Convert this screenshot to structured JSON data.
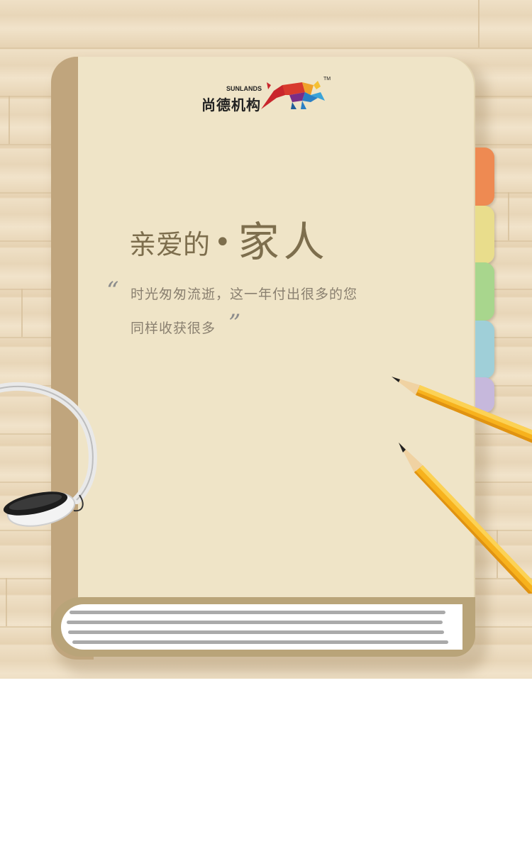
{
  "brand": {
    "name_cn": "尚德机构",
    "name_en": "SUNLANDS",
    "trademark": "TM"
  },
  "heading": {
    "small": "亲爱的",
    "dot": "•",
    "big": "家人"
  },
  "quote": {
    "open_mark": "“",
    "close_mark": "”",
    "line1": "时光匆匆流逝，这一年付出很多的您",
    "line2": "同样收获很多"
  },
  "decor": {
    "icons": [
      "bull-logo-icon",
      "headphones-icon",
      "pencil-icon"
    ],
    "tab_colors": [
      "#ee8a52",
      "#e9dd8c",
      "#a8d68d",
      "#9fcfd8",
      "#c6b8dc"
    ],
    "book_cover_color": "#efe4c7",
    "book_spine_color": "#c0a57d",
    "heading_color": "#7d6e4d"
  }
}
